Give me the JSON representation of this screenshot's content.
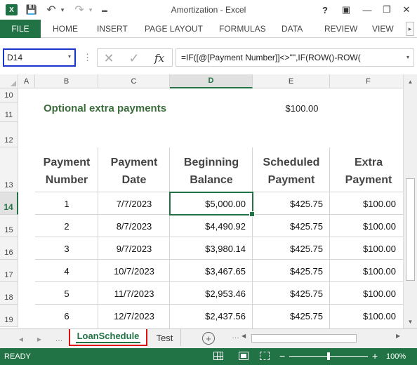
{
  "window": {
    "title": "Amortization - Excel",
    "logo_text": "X",
    "quick_access": {
      "save": "💾",
      "undo": "↶",
      "undo_dd": "▾",
      "redo": "↷",
      "redo_dd": "▾",
      "customize": "▬"
    },
    "controls": {
      "help": "?",
      "ribbon_options": "▣",
      "minimize": "—",
      "restore": "❐",
      "close": "✕"
    }
  },
  "ribbon": {
    "file": "FILE",
    "tabs": [
      "HOME",
      "INSERT",
      "PAGE LAYOUT",
      "FORMULAS",
      "DATA",
      "REVIEW",
      "VIEW"
    ],
    "more": "▸"
  },
  "formula_bar": {
    "name_box": "D14",
    "separator": "⋮",
    "cancel": "✕",
    "enter": "✓",
    "fx": "fx",
    "formula": "=IF([@[Payment Number]]<>\"\",IF(ROW()-ROW(",
    "dropdown": "▾"
  },
  "grid": {
    "columns": [
      "A",
      "B",
      "C",
      "D",
      "E",
      "F"
    ],
    "selected_column": "D",
    "rows": [
      "10",
      "11",
      "12",
      "13",
      "14",
      "15",
      "16",
      "17",
      "18",
      "19"
    ],
    "selected_row": "14",
    "extra_payments_label": "Optional extra payments",
    "extra_payments_value": "$100.00",
    "headers": [
      {
        "line1": "Payment",
        "line2": "Number"
      },
      {
        "line1": "Payment",
        "line2": "Date"
      },
      {
        "line1": "Beginning",
        "line2": "Balance"
      },
      {
        "line1": "Scheduled",
        "line2": "Payment"
      },
      {
        "line1": "Extra",
        "line2": "Payment"
      }
    ],
    "data": [
      {
        "num": "1",
        "date": "7/7/2023",
        "balance": "$5,000.00",
        "scheduled": "$425.75",
        "extra": "$100.00"
      },
      {
        "num": "2",
        "date": "8/7/2023",
        "balance": "$4,490.92",
        "scheduled": "$425.75",
        "extra": "$100.00"
      },
      {
        "num": "3",
        "date": "9/7/2023",
        "balance": "$3,980.14",
        "scheduled": "$425.75",
        "extra": "$100.00"
      },
      {
        "num": "4",
        "date": "10/7/2023",
        "balance": "$3,467.65",
        "scheduled": "$425.75",
        "extra": "$100.00"
      },
      {
        "num": "5",
        "date": "11/7/2023",
        "balance": "$2,953.46",
        "scheduled": "$425.75",
        "extra": "$100.00"
      },
      {
        "num": "6",
        "date": "12/7/2023",
        "balance": "$2,437.56",
        "scheduled": "$425.75",
        "extra": "$100.00"
      }
    ]
  },
  "sheets": {
    "nav_prev": "◀",
    "nav_next": "▶",
    "dots": "…",
    "tabs": [
      "LoanSchedule",
      "Test"
    ],
    "add": "+",
    "scroll_left": "◀",
    "scroll_right": "▶"
  },
  "scrollbar": {
    "up": "▲",
    "down": "▼"
  },
  "status": {
    "mode": "READY",
    "zoom_minus": "−",
    "zoom_plus": "+",
    "zoom": "100%"
  },
  "colors": {
    "accent": "#217346",
    "name_box_border": "#1a35cc",
    "tab_highlight": "#dd1111"
  }
}
